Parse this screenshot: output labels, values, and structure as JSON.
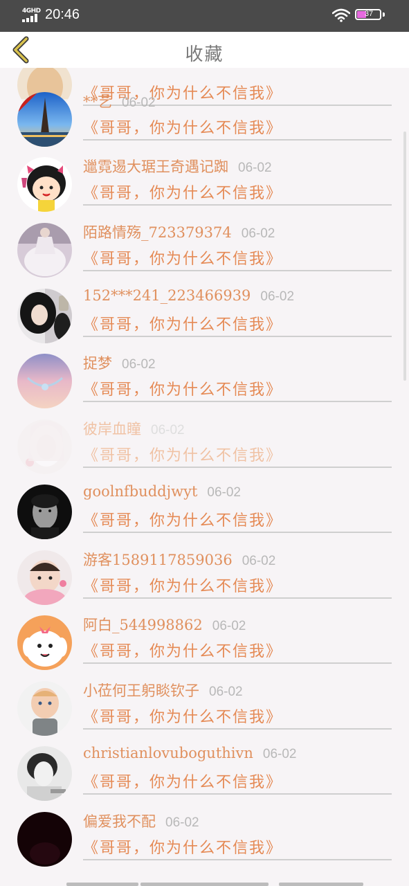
{
  "status_bar": {
    "network": "4GHD",
    "time": "20:46",
    "battery": "37"
  },
  "header": {
    "title": "收藏",
    "back_icon": "chevron-left-icon"
  },
  "colors": {
    "name": "#e0905e",
    "quote": "#e58a55",
    "date": "#b8b8b8",
    "back": "#c9b24a"
  },
  "favorites": [
    {
      "name": "",
      "date": "",
      "quote": "《哥哥，你为什么不信我》",
      "avatar": "avatar-partial"
    },
    {
      "name": "**艺",
      "date": "06-02",
      "quote": "《哥哥，你为什么不信我》",
      "avatar": "eiffel-tower"
    },
    {
      "name": "邋霓逷大琚王奇遇记踟",
      "date": "06-02",
      "quote": "《哥哥，你为什么不信我》",
      "avatar": "cartoon-girl"
    },
    {
      "name": "陌路情殇_723379374",
      "date": "06-02",
      "quote": "《哥哥，你为什么不信我》",
      "avatar": "white-dress"
    },
    {
      "name": "152***241_223466939",
      "date": "06-02",
      "quote": "《哥哥，你为什么不信我》",
      "avatar": "selfie-girl"
    },
    {
      "name": "捉梦",
      "date": "06-02",
      "quote": "《哥哥，你为什么不信我》",
      "avatar": "pastel-sky"
    },
    {
      "name": "彼岸血瞳",
      "date": "06-02",
      "quote": "《哥哥，你为什么不信我》",
      "avatar": "pale-anime",
      "faded": true
    },
    {
      "name": "goolnfbuddjwyt",
      "date": "06-02",
      "quote": "《哥哥，你为什么不信我》",
      "avatar": "dark-portrait"
    },
    {
      "name": "游客1589117859036",
      "date": "06-02",
      "quote": "《哥哥，你为什么不信我》",
      "avatar": "pink-baby"
    },
    {
      "name": "阿白_544998862",
      "date": "06-02",
      "quote": "《哥哥，你为什么不信我》",
      "avatar": "white-dog-cartoon"
    },
    {
      "name": "小莅何王躬睒钦子",
      "date": "06-02",
      "quote": "《哥哥，你为什么不信我》",
      "avatar": "toddler"
    },
    {
      "name": "christianlovuboguthivn",
      "date": "06-02",
      "quote": "《哥哥，你为什么不信我》",
      "avatar": "bw-boy"
    },
    {
      "name": "偏爱我不配",
      "date": "06-02",
      "quote": "《哥哥，你为什么不信我》",
      "avatar": "dark-red"
    }
  ]
}
